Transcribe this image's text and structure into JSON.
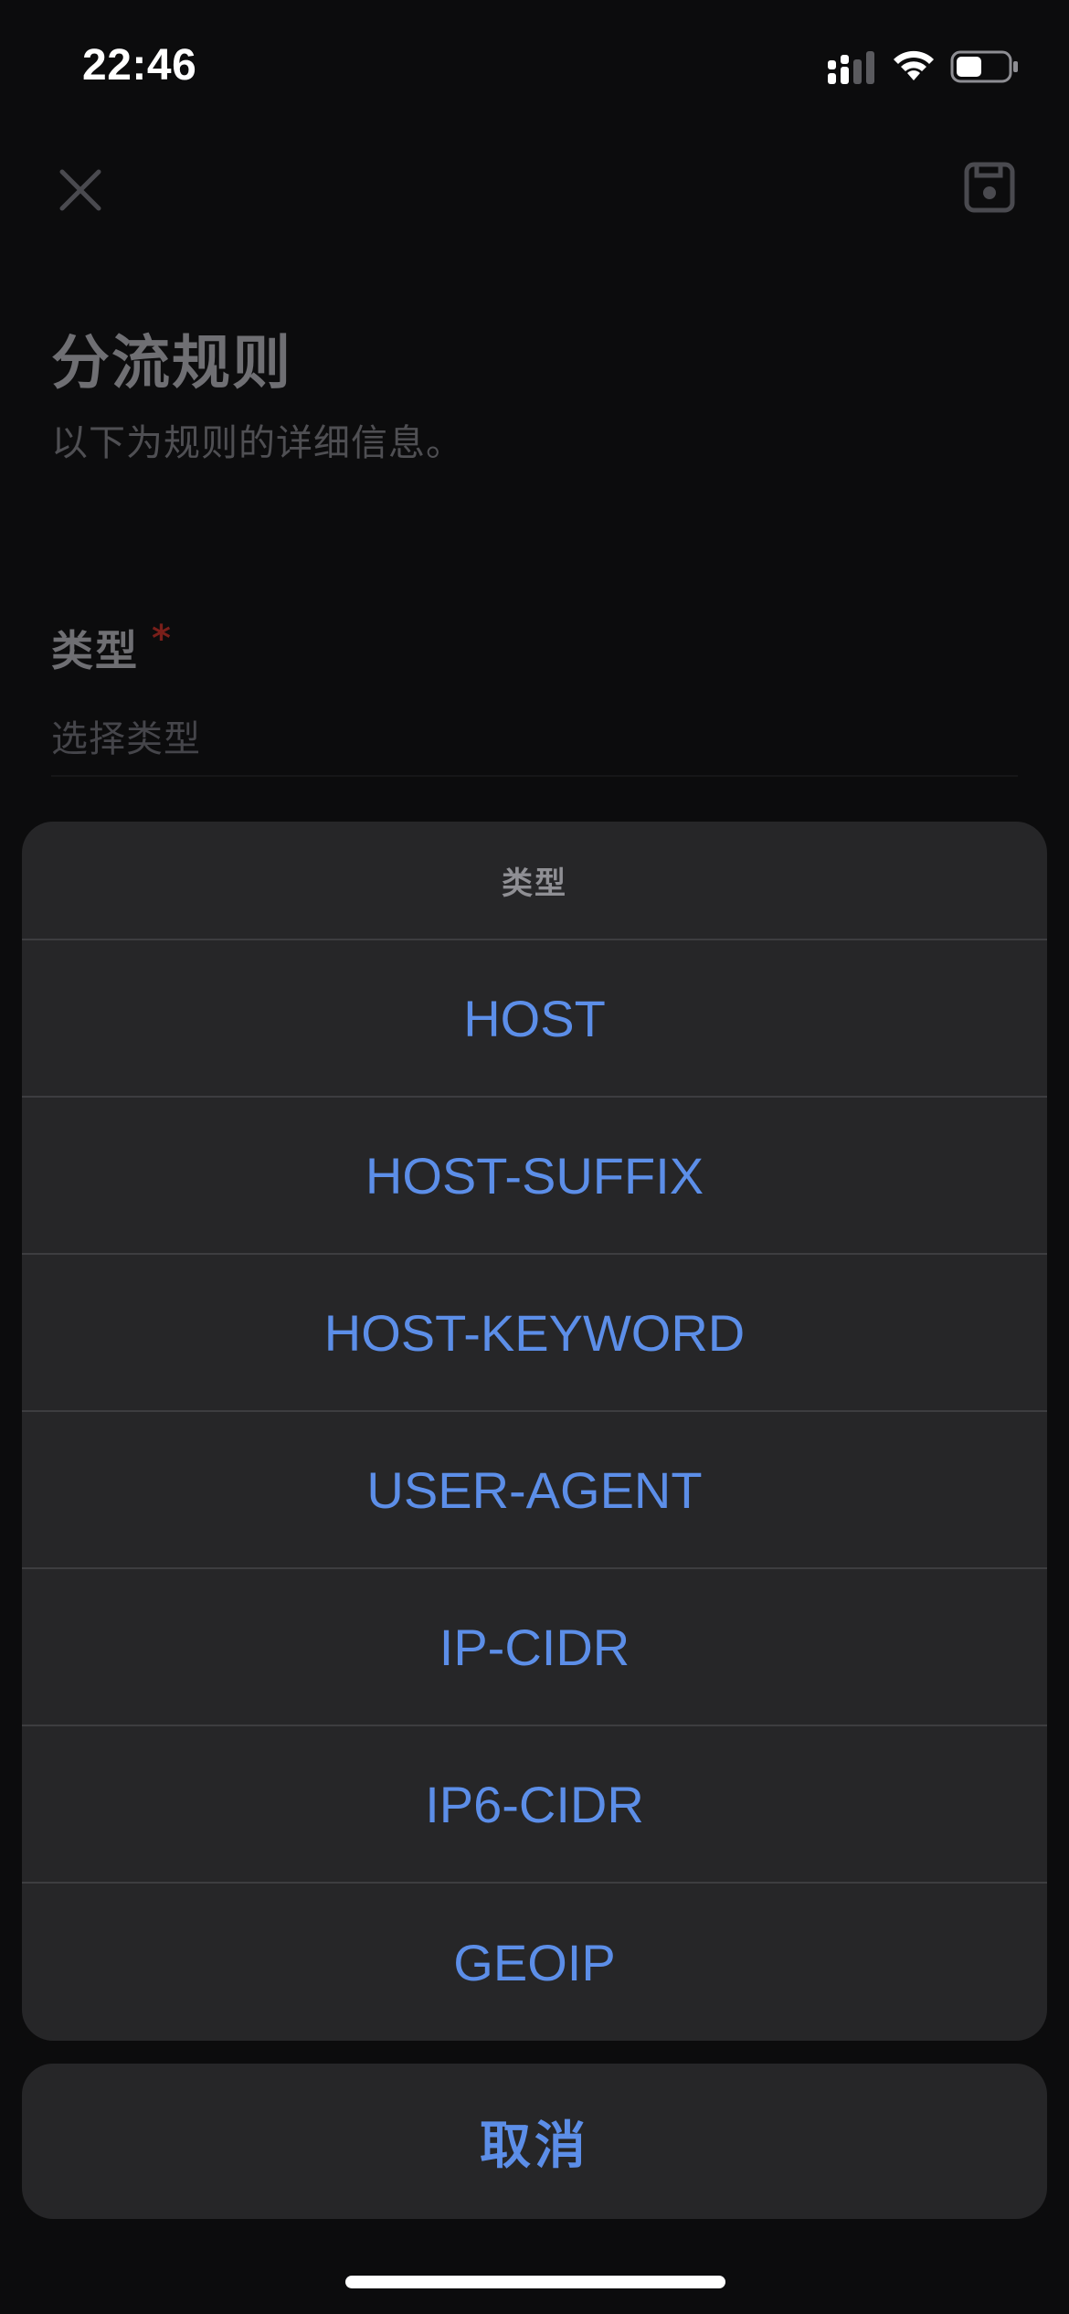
{
  "status_bar": {
    "time": "22:46",
    "signal_icon": "cellular-signal-icon",
    "wifi_icon": "wifi-icon",
    "battery_icon": "battery-icon",
    "battery_level": 0.5
  },
  "page": {
    "close_icon": "close-icon",
    "save_icon": "save-icon",
    "title": "分流规则",
    "subtitle": "以下为规则的详细信息。",
    "type_field": {
      "label": "类型",
      "required_mark": "*",
      "placeholder": "选择类型"
    }
  },
  "action_sheet": {
    "title": "类型",
    "options": [
      "HOST",
      "HOST-SUFFIX",
      "HOST-KEYWORD",
      "USER-AGENT",
      "IP-CIDR",
      "IP6-CIDR",
      "GEOIP"
    ],
    "cancel_label": "取消"
  },
  "colors": {
    "background": "#0c0c0d",
    "sheet": "#262628",
    "accent": "#5c8ee8",
    "required": "#7a1f1a"
  }
}
